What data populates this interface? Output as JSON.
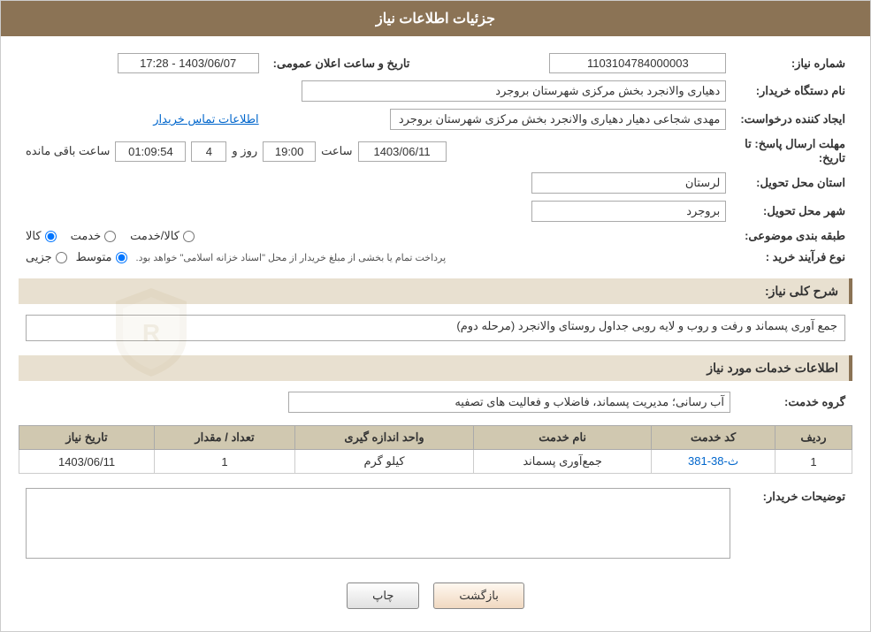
{
  "header": {
    "title": "جزئیات اطلاعات نیاز"
  },
  "fields": {
    "need_number_label": "شماره نیاز:",
    "need_number_value": "1103104784000003",
    "announcement_label": "تاریخ و ساعت اعلان عمومی:",
    "announcement_value": "1403/06/07 - 17:28",
    "org_name_label": "نام دستگاه خریدار:",
    "org_name_value": "دهیاری والانجرد بخش مرکزی شهرستان بروجرد",
    "requester_label": "ایجاد کننده درخواست:",
    "requester_value": "مهدی شجاعی دهیار دهیاری والانجرد بخش مرکزی شهرستان بروجرد",
    "contact_link": "اطلاعات تماس خریدار",
    "deadline_label": "مهلت ارسال پاسخ: تا تاریخ:",
    "deadline_date": "1403/06/11",
    "deadline_time_label": "ساعت",
    "deadline_time": "19:00",
    "deadline_days_label": "روز و",
    "deadline_days": "4",
    "deadline_remaining_label": "ساعت باقی مانده",
    "deadline_remaining": "01:09:54",
    "province_label": "استان محل تحویل:",
    "province_value": "لرستان",
    "city_label": "شهر محل تحویل:",
    "city_value": "بروجرد",
    "category_label": "طبقه بندی موضوعی:",
    "category_kala": "کالا",
    "category_khadamat": "خدمت",
    "category_kala_khadamat": "کالا/خدمت",
    "purchase_type_label": "نوع فرآیند خرید :",
    "purchase_type_jezyi": "جزیی",
    "purchase_type_mottasat": "متوسط",
    "purchase_type_note": "پرداخت تمام یا بخشی از مبلغ خریدار از محل \"اسناد خزانه اسلامی\" خواهد بود.",
    "general_desc_label": "شرح کلی نیاز:",
    "general_desc_value": "جمع آوری پسماند و رفت و روب و لایه روبی جداول روستای والانجرد (مرحله دوم)",
    "services_section_label": "اطلاعات خدمات مورد نیاز",
    "service_group_label": "گروه خدمت:",
    "service_group_value": "آب رسانی؛ مدیریت پسماند، فاضلاب و فعالیت های تصفیه",
    "buyer_notes_label": "توضیحات خریدار:"
  },
  "table": {
    "headers": [
      "ردیف",
      "کد خدمت",
      "نام خدمت",
      "واحد اندازه گیری",
      "تعداد / مقدار",
      "تاریخ نیاز"
    ],
    "rows": [
      {
        "row": "1",
        "code": "ث-38-381",
        "name": "جمع‌آوری پسماند",
        "unit": "کیلو گرم",
        "count": "1",
        "date": "1403/06/11"
      }
    ]
  },
  "buttons": {
    "print": "چاپ",
    "back": "بازگشت"
  }
}
